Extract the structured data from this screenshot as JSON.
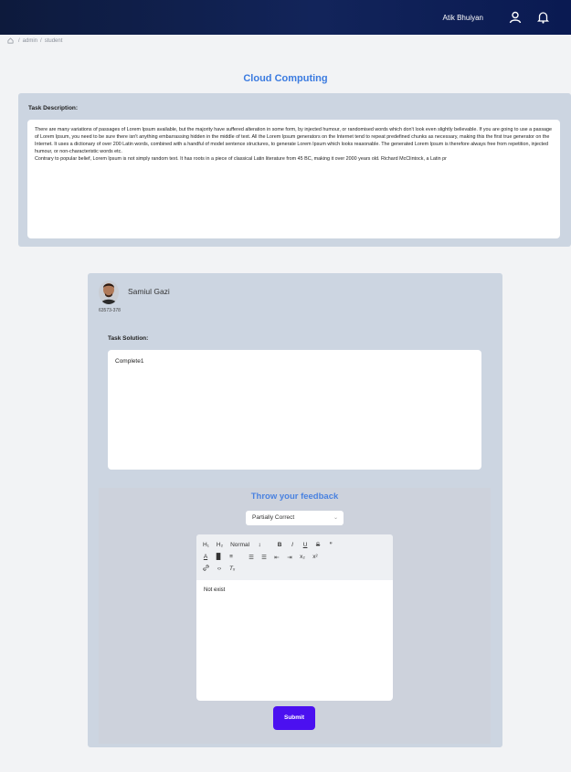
{
  "topbar": {
    "user_name": "Atik Bhuiyan",
    "icons": [
      "user-icon",
      "bell-icon"
    ],
    "colors": {
      "bar": "#0d1a3c"
    }
  },
  "breadcrumb": {
    "items": [
      "admin",
      "student"
    ],
    "separator": "/"
  },
  "page": {
    "title": "Cloud Computing",
    "accent": "#3b7be0"
  },
  "task_description": {
    "label": "Task Description:",
    "text_1": "There are many variations of passages of Lorem Ipsum available, but the majority have suffered alteration in some form, by injected humour, or randomised words which don't look even slightly believable. If you are going to use a passage of Lorem Ipsum, you need to be sure there isn't anything embarrassing hidden in the middle of text. All the Lorem Ipsum generators on the Internet tend to repeat predefined chunks as necessary, making this the first true generator on the Internet. It uses a dictionary of over 200 Latin words, combined with a handful of model sentence structures, to generate Lorem Ipsum which looks reasonable. The generated Lorem Ipsum is therefore always free from repetition, injected humour, or non-characteristic words etc.",
    "text_2": "Contrary to popular belief, Lorem Ipsum is not simply random text. It has roots in a piece of classical Latin literature from 45 BC, making it over 2000 years old. Richard McClintock, a Latin pr"
  },
  "student": {
    "name": "Samiul Gazi",
    "id": "63573-378"
  },
  "solution": {
    "label": "Task Solution:",
    "text": "Complete1"
  },
  "feedback": {
    "title": "Throw your feedback",
    "status_selected": "Partially Correct",
    "toolbar": {
      "h1": "H₁",
      "h2": "H₂",
      "size": "Normal",
      "size_arrow": "↕",
      "bold": "B",
      "italic": "I",
      "underline": "U",
      "strike": "S",
      "quote": "”",
      "color": "A",
      "bg": "█",
      "align": "≡",
      "ol": "☰",
      "ul": "☰",
      "indent_out": "⇤",
      "indent_in": "⇥",
      "sub": "x₂",
      "sup": "x²",
      "link": "🔗",
      "code": "‹›",
      "clean": "Tₓ"
    },
    "editor_text": "Not exist",
    "submit_label": "Submit",
    "submit_color": "#4b10f0"
  }
}
